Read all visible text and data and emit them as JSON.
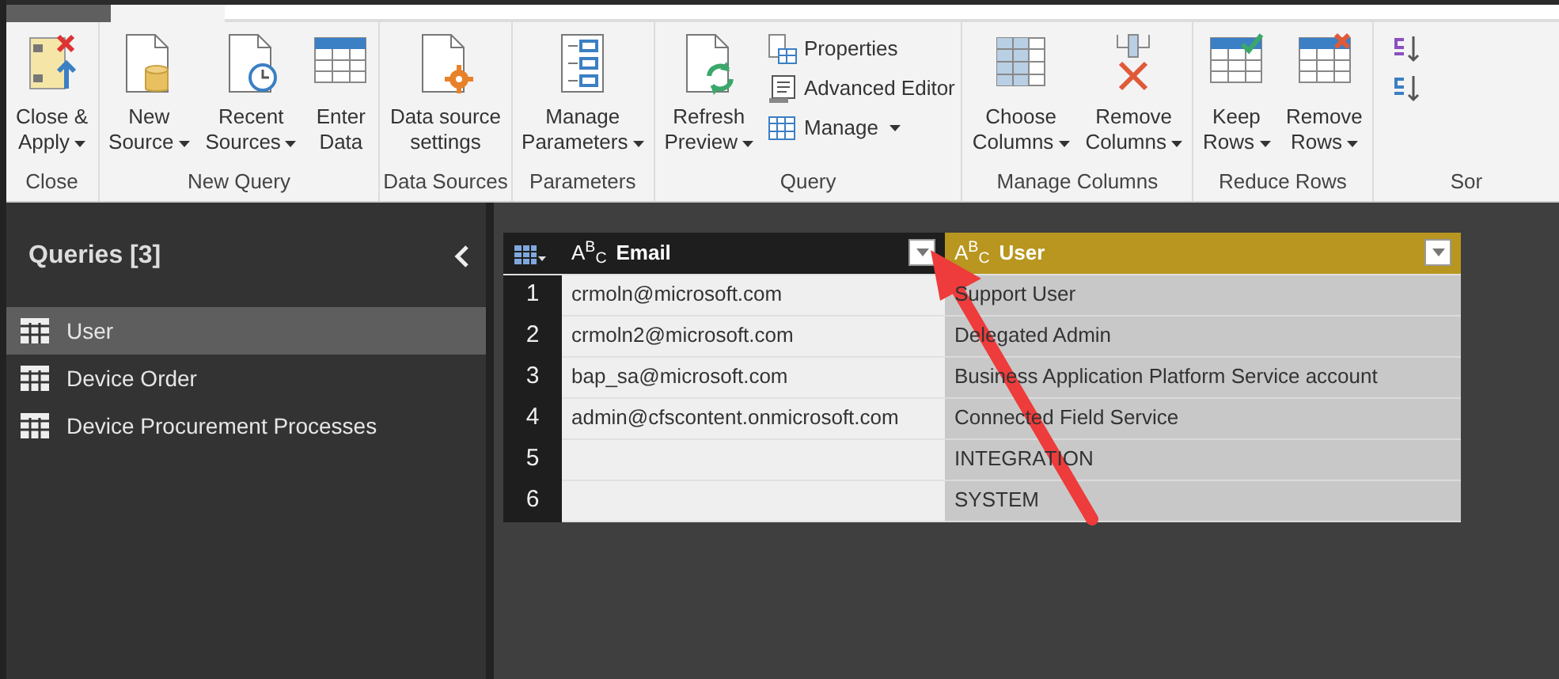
{
  "ribbon": {
    "groups": [
      {
        "label": "Close",
        "items": [
          {
            "kind": "large",
            "lines": [
              "Close &",
              "Apply"
            ],
            "dropdown": true
          }
        ]
      },
      {
        "label": "New Query",
        "items": [
          {
            "kind": "large",
            "lines": [
              "New",
              "Source"
            ],
            "dropdown": true
          },
          {
            "kind": "large",
            "lines": [
              "Recent",
              "Sources"
            ],
            "dropdown": true
          },
          {
            "kind": "large",
            "lines": [
              "Enter",
              "Data"
            ],
            "dropdown": false
          }
        ]
      },
      {
        "label": "Data Sources",
        "items": [
          {
            "kind": "large",
            "lines": [
              "Data source",
              "settings"
            ],
            "dropdown": false
          }
        ]
      },
      {
        "label": "Parameters",
        "items": [
          {
            "kind": "large",
            "lines": [
              "Manage",
              "Parameters"
            ],
            "dropdown": true
          }
        ]
      },
      {
        "label": "Query",
        "items": [
          {
            "kind": "large",
            "lines": [
              "Refresh",
              "Preview"
            ],
            "dropdown": true
          },
          {
            "kind": "small",
            "lines": [
              "Properties"
            ],
            "dropdown": false
          },
          {
            "kind": "small",
            "lines": [
              "Advanced Editor"
            ],
            "dropdown": false
          },
          {
            "kind": "small",
            "lines": [
              "Manage"
            ],
            "dropdown": true
          }
        ]
      },
      {
        "label": "Manage Columns",
        "items": [
          {
            "kind": "large",
            "lines": [
              "Choose",
              "Columns"
            ],
            "dropdown": true
          },
          {
            "kind": "large",
            "lines": [
              "Remove",
              "Columns"
            ],
            "dropdown": true
          }
        ]
      },
      {
        "label": "Reduce Rows",
        "items": [
          {
            "kind": "large",
            "lines": [
              "Keep",
              "Rows"
            ],
            "dropdown": true
          },
          {
            "kind": "large",
            "lines": [
              "Remove",
              "Rows"
            ],
            "dropdown": true
          }
        ]
      },
      {
        "label": "Sor",
        "items": [
          {
            "kind": "icon"
          },
          {
            "kind": "icon"
          }
        ]
      }
    ]
  },
  "queries": {
    "title": "Queries [3]",
    "items": [
      {
        "label": "User",
        "selected": true
      },
      {
        "label": "Device Order",
        "selected": false
      },
      {
        "label": "Device Procurement Processes",
        "selected": false
      }
    ]
  },
  "table": {
    "columns": [
      {
        "type": "A$^{B}$$_{C}$",
        "name": "Email",
        "selected": false
      },
      {
        "type": "A$^{B}$$_{C}$",
        "name": "User",
        "selected": true
      }
    ],
    "rows": [
      {
        "index": "1",
        "cells": [
          "crmoln@microsoft.com",
          "Support User"
        ]
      },
      {
        "index": "2",
        "cells": [
          "crmoln2@microsoft.com",
          "Delegated Admin"
        ]
      },
      {
        "index": "3",
        "cells": [
          "bap_sa@microsoft.com",
          "Business Application Platform Service account"
        ]
      },
      {
        "index": "4",
        "cells": [
          "admin@cfscontent.onmicrosoft.com",
          "Connected Field Service"
        ]
      },
      {
        "index": "5",
        "cells": [
          "",
          "INTEGRATION"
        ]
      },
      {
        "index": "6",
        "cells": [
          "",
          "SYSTEM"
        ]
      }
    ]
  }
}
